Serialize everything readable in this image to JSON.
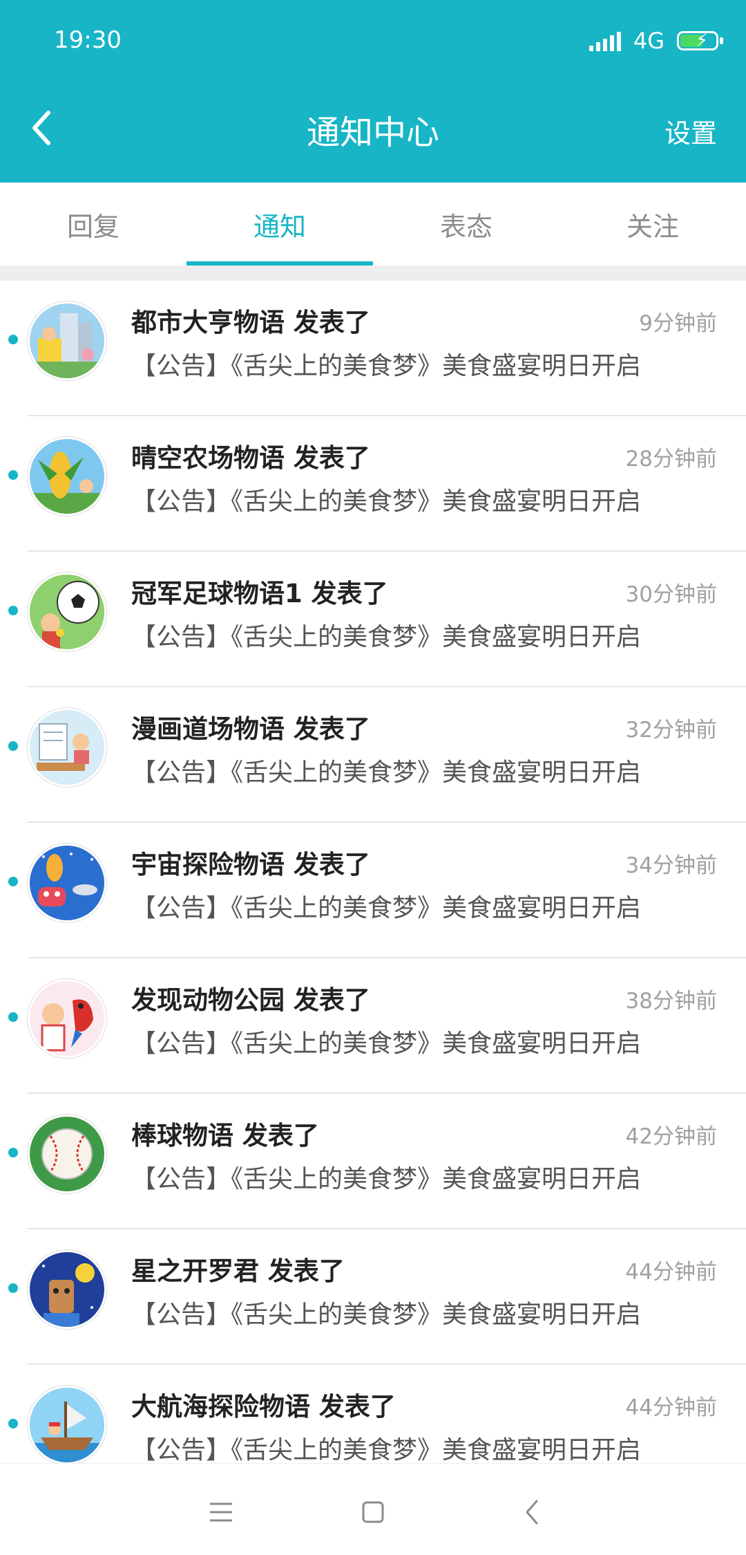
{
  "status_bar": {
    "time": "19:30",
    "network": "4G"
  },
  "header": {
    "title": "通知中心",
    "settings_label": "设置"
  },
  "tabs": [
    {
      "label": "回复",
      "active": false
    },
    {
      "label": "通知",
      "active": true
    },
    {
      "label": "表态",
      "active": false
    },
    {
      "label": "关注",
      "active": false
    }
  ],
  "colors": {
    "accent": "#17b5c6",
    "unread_dot": "#17b5c6"
  },
  "notifications": [
    {
      "title": "都市大亨物语 发表了",
      "time": "9分钟前",
      "body": "【公告】《舌尖上的美食梦》美食盛宴明日开启",
      "unread": true,
      "avatar_icon": "city-game-avatar-icon"
    },
    {
      "title": "晴空农场物语 发表了",
      "time": "28分钟前",
      "body": "【公告】《舌尖上的美食梦》美食盛宴明日开启",
      "unread": true,
      "avatar_icon": "farm-game-avatar-icon"
    },
    {
      "title": "冠军足球物语1 发表了",
      "time": "30分钟前",
      "body": "【公告】《舌尖上的美食梦》美食盛宴明日开启",
      "unread": true,
      "avatar_icon": "soccer-game-avatar-icon"
    },
    {
      "title": "漫画道场物语 发表了",
      "time": "32分钟前",
      "body": "【公告】《舌尖上的美食梦》美食盛宴明日开启",
      "unread": true,
      "avatar_icon": "manga-game-avatar-icon"
    },
    {
      "title": "宇宙探险物语 发表了",
      "time": "34分钟前",
      "body": "【公告】《舌尖上的美食梦》美食盛宴明日开启",
      "unread": true,
      "avatar_icon": "space-game-avatar-icon"
    },
    {
      "title": "发现动物公园 发表了",
      "time": "38分钟前",
      "body": "【公告】《舌尖上的美食梦》美食盛宴明日开启",
      "unread": true,
      "avatar_icon": "zoo-game-avatar-icon"
    },
    {
      "title": "棒球物语 发表了",
      "time": "42分钟前",
      "body": "【公告】《舌尖上的美食梦》美食盛宴明日开启",
      "unread": true,
      "avatar_icon": "baseball-game-avatar-icon"
    },
    {
      "title": "星之开罗君 发表了",
      "time": "44分钟前",
      "body": "【公告】《舌尖上的美食梦》美食盛宴明日开启",
      "unread": true,
      "avatar_icon": "kairo-game-avatar-icon"
    },
    {
      "title": "大航海探险物语 发表了",
      "time": "44分钟前",
      "body": "【公告】《舌尖上的美食梦》美食盛宴明日开启",
      "unread": true,
      "avatar_icon": "voyage-game-avatar-icon"
    }
  ],
  "nav_bar": {
    "icons": [
      "menu-icon",
      "home-icon",
      "back-icon"
    ]
  }
}
